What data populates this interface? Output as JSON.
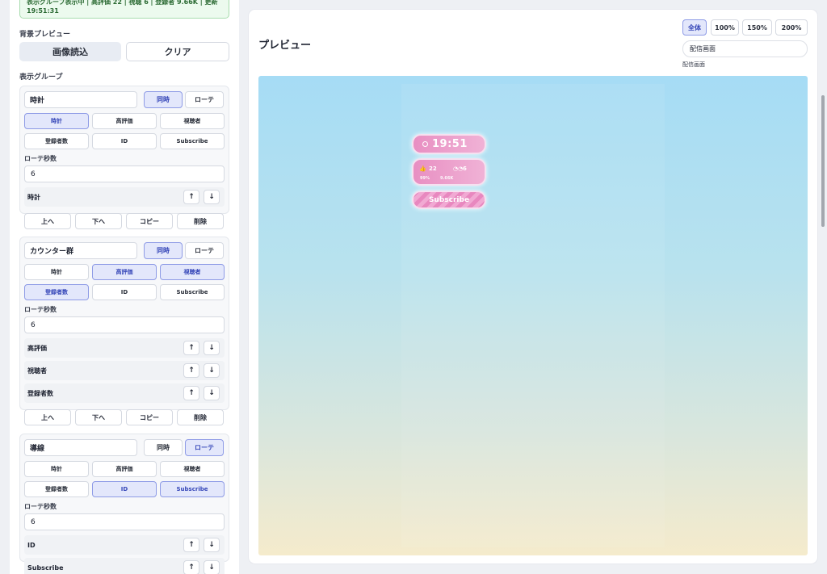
{
  "status": {
    "line1": "表示グループ表示中 | 高評価 22 | 視聴 6 | 登録者 9.66K | 更新",
    "line2": "19:51:31"
  },
  "background": {
    "label": "背景プレビュー",
    "load_button": "画像読込",
    "clear_button": "クリア"
  },
  "groups_label": "表示グループ",
  "mode_labels": {
    "simultaneous": "同時",
    "rotate": "ローテ"
  },
  "source_labels": [
    "時計",
    "高評価",
    "視聴者",
    "登録者数",
    "ID",
    "Subscribe"
  ],
  "rotation_label": "ローテ秒数",
  "action_labels": {
    "up": "上へ",
    "down": "下へ",
    "copy": "コピー",
    "delete": "削除"
  },
  "arrows": {
    "up": "↑",
    "down": "↓"
  },
  "groups": [
    {
      "name": "時計",
      "mode": "simultaneous",
      "selected": [
        "時計"
      ],
      "rotation_seconds": "6",
      "order": [
        "時計"
      ]
    },
    {
      "name": "カウンター群",
      "mode": "simultaneous",
      "selected": [
        "高評価",
        "視聴者",
        "登録者数"
      ],
      "rotation_seconds": "6",
      "order": [
        "高評価",
        "視聴者",
        "登録者数"
      ]
    },
    {
      "name": "導線",
      "mode": "rotate",
      "selected": [
        "ID",
        "Subscribe"
      ],
      "rotation_seconds": "6",
      "order": [
        "ID",
        "Subscribe"
      ]
    }
  ],
  "preview": {
    "title": "プレビュー",
    "zoom_options": [
      "全体",
      "100%",
      "150%",
      "200%"
    ],
    "zoom_selected": "全体",
    "scene_select_value": "配信画面",
    "scene_caption": "配信画面",
    "overlay": {
      "clock": "19:51",
      "likes_value": "22",
      "viewers_value": "6",
      "likes_label": "99%",
      "subscribers_label": "9.66K",
      "subscribe_text": "Subscribe"
    }
  },
  "colors": {
    "accent": "#3546b8",
    "selected_bg": "#e3e7fb",
    "overlay_pink": "#e88fc2",
    "status_green": "#ecfaee"
  }
}
